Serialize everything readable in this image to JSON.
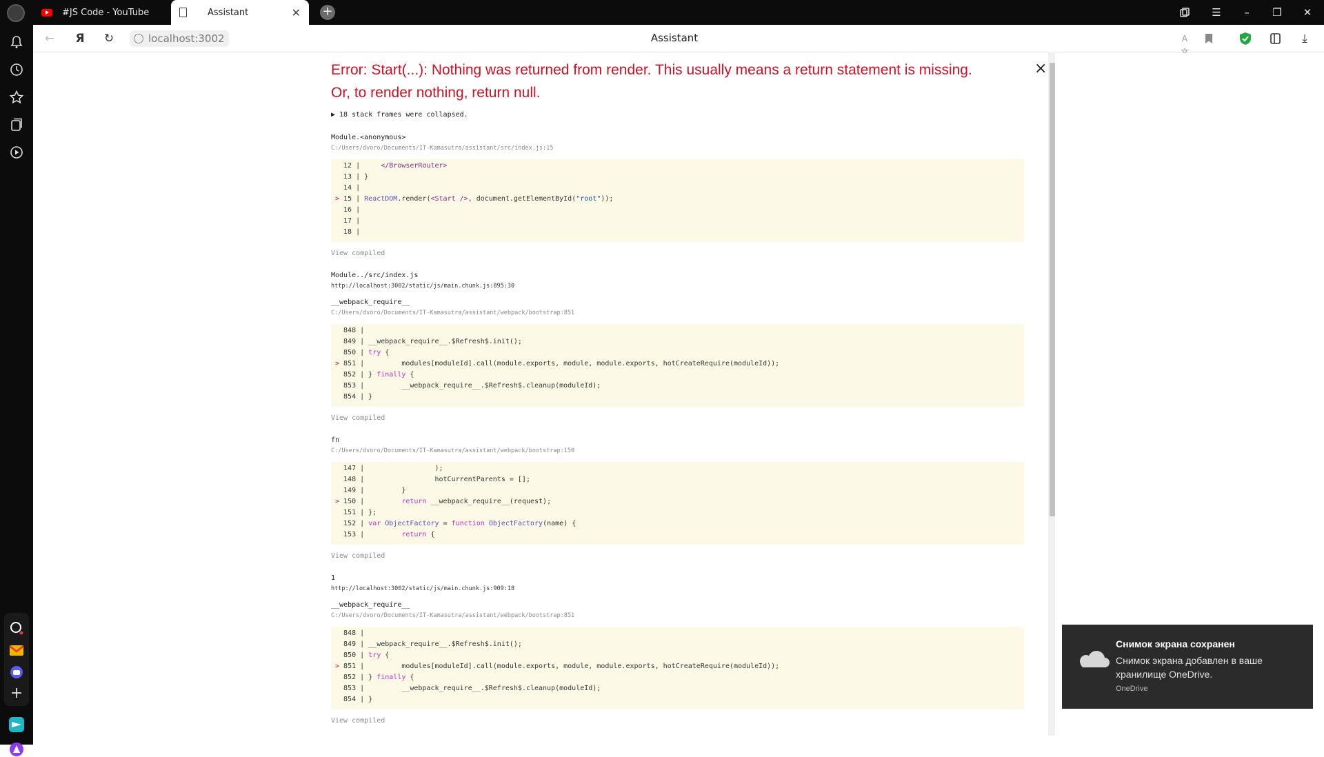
{
  "tabs": [
    {
      "title": "#JS Code - YouTube",
      "icon": "youtube-icon"
    },
    {
      "title": "Assistant",
      "icon": "page-icon",
      "active": true
    }
  ],
  "address": {
    "url": "localhost:3002",
    "page_title": "Assistant"
  },
  "error": {
    "title": "Error: Start(...): Nothing was returned from render. This usually means a return statement is missing. Or, to render nothing, return null.",
    "collapsed": "▶ 18 stack frames were collapsed.",
    "view_compiled": "View compiled",
    "frames": [
      {
        "name": "Module.<anonymous>",
        "file": "C:/Users/dvoro/Documents/IT-Kamasutra/assistant/src/index.js:15"
      },
      {
        "name": "Module../src/index.js",
        "file": "http://localhost:3002/static/js/main.chunk.js:895:30"
      },
      {
        "name": "__webpack_require__",
        "file": "C:/Users/dvoro/Documents/IT-Kamasutra/assistant/webpack/bootstrap:851"
      },
      {
        "name": "fn",
        "file": "C:/Users/dvoro/Documents/IT-Kamasutra/assistant/webpack/bootstrap:150"
      },
      {
        "name": "1",
        "file": "http://localhost:3002/static/js/main.chunk.js:909:18"
      },
      {
        "name": "__webpack_require__",
        "file": "C:/Users/dvoro/Documents/IT-Kamasutra/assistant/webpack/bootstrap:851"
      }
    ],
    "code_blocks": [
      [
        "  12 |     </BrowserRouter>",
        "  13 | }",
        "  14 |",
        "> 15 | ReactDOM.render(<Start />, document.getElementById(\"root\"));",
        "  16 |",
        "  17 |",
        "  18 |"
      ],
      [
        "  848 |",
        "  849 | __webpack_require__.$Refresh$.init();",
        "  850 | try {",
        "> 851 |         modules[moduleId].call(module.exports, module, module.exports, hotCreateRequire(moduleId));",
        "  852 | } finally {",
        "  853 |         __webpack_require__.$Refresh$.cleanup(moduleId);",
        "  854 | }"
      ],
      [
        "  147 |                 );",
        "  148 |                 hotCurrentParents = [];",
        "  149 |         }",
        "> 150 |         return __webpack_require__(request);",
        "  151 | };",
        "  152 | var ObjectFactory = function ObjectFactory(name) {",
        "  153 |         return {"
      ],
      [
        "  848 |",
        "  849 | __webpack_require__.$Refresh$.init();",
        "  850 | try {",
        "> 851 |         modules[moduleId].call(module.exports, module, module.exports, hotCreateRequire(moduleId));",
        "  852 | } finally {",
        "  853 |         __webpack_require__.$Refresh$.cleanup(moduleId);",
        "  854 | }"
      ]
    ]
  },
  "toast": {
    "title": "Снимок экрана сохранен",
    "body": "Снимок экрана добавлен в ваше хранилище OneDrive.",
    "source": "OneDrive"
  },
  "colors": {
    "error": "#ce1126",
    "code_bg": "#fcfae6",
    "tabstrip": "#0c0c0c",
    "toast_bg": "#2b2b2b"
  }
}
